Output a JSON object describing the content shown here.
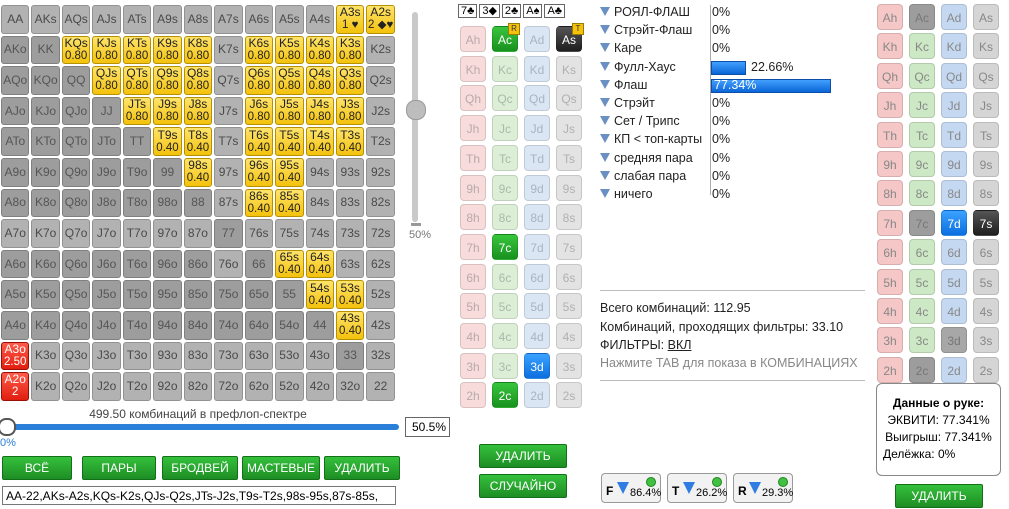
{
  "matrix": {
    "rows": [
      [
        [
          "AA",
          "",
          "g1"
        ],
        [
          "AKs",
          "",
          "g1"
        ],
        [
          "AQs",
          "",
          "g1"
        ],
        [
          "AJs",
          "",
          "g1"
        ],
        [
          "ATs",
          "",
          "g1"
        ],
        [
          "A9s",
          "",
          "g1"
        ],
        [
          "A8s",
          "",
          "g1"
        ],
        [
          "A7s",
          "",
          "g1"
        ],
        [
          "A6s",
          "",
          "g1"
        ],
        [
          "A5s",
          "",
          "g1"
        ],
        [
          "A4s",
          "",
          "g1"
        ],
        [
          "A3s",
          "1 ♥",
          "yel"
        ],
        [
          "A2s",
          "2 ◆♥",
          "yel"
        ]
      ],
      [
        [
          "AKo",
          "",
          "g0"
        ],
        [
          "KK",
          "",
          "g0"
        ],
        [
          "KQs",
          "0.80",
          "yel"
        ],
        [
          "KJs",
          "0.80",
          "yel"
        ],
        [
          "KTs",
          "0.80",
          "yel"
        ],
        [
          "K9s",
          "0.80",
          "yel"
        ],
        [
          "K8s",
          "0.80",
          "yel"
        ],
        [
          "K7s",
          "",
          "g1"
        ],
        [
          "K6s",
          "0.80",
          "yel"
        ],
        [
          "K5s",
          "0.80",
          "yel"
        ],
        [
          "K4s",
          "0.80",
          "yel"
        ],
        [
          "K3s",
          "0.80",
          "yel"
        ],
        [
          "K2s",
          "",
          "g1"
        ]
      ],
      [
        [
          "AQo",
          "",
          "g0"
        ],
        [
          "KQo",
          "",
          "g0"
        ],
        [
          "QQ",
          "",
          "g0"
        ],
        [
          "QJs",
          "0.80",
          "yel"
        ],
        [
          "QTs",
          "0.80",
          "yel"
        ],
        [
          "Q9s",
          "0.80",
          "yel"
        ],
        [
          "Q8s",
          "0.80",
          "yel"
        ],
        [
          "Q7s",
          "",
          "g1"
        ],
        [
          "Q6s",
          "0.80",
          "yel"
        ],
        [
          "Q5s",
          "0.80",
          "yel"
        ],
        [
          "Q4s",
          "0.80",
          "yel"
        ],
        [
          "Q3s",
          "0.80",
          "yel"
        ],
        [
          "Q2s",
          "",
          "g1"
        ]
      ],
      [
        [
          "AJo",
          "",
          "g0"
        ],
        [
          "KJo",
          "",
          "g0"
        ],
        [
          "QJo",
          "",
          "g0"
        ],
        [
          "JJ",
          "",
          "g0"
        ],
        [
          "JTs",
          "0.80",
          "yel"
        ],
        [
          "J9s",
          "0.80",
          "yel"
        ],
        [
          "J8s",
          "0.80",
          "yel"
        ],
        [
          "J7s",
          "",
          "g1"
        ],
        [
          "J6s",
          "0.80",
          "yel"
        ],
        [
          "J5s",
          "0.80",
          "yel"
        ],
        [
          "J4s",
          "0.80",
          "yel"
        ],
        [
          "J3s",
          "0.80",
          "yel"
        ],
        [
          "J2s",
          "",
          "g1"
        ]
      ],
      [
        [
          "ATo",
          "",
          "g0"
        ],
        [
          "KTo",
          "",
          "g0"
        ],
        [
          "QTo",
          "",
          "g0"
        ],
        [
          "JTo",
          "",
          "g0"
        ],
        [
          "TT",
          "",
          "g0"
        ],
        [
          "T9s",
          "0.40",
          "yel"
        ],
        [
          "T8s",
          "0.40",
          "yel"
        ],
        [
          "T7s",
          "",
          "g1"
        ],
        [
          "T6s",
          "0.40",
          "yel"
        ],
        [
          "T5s",
          "0.40",
          "yel"
        ],
        [
          "T4s",
          "0.40",
          "yel"
        ],
        [
          "T3s",
          "0.40",
          "yel"
        ],
        [
          "T2s",
          "",
          "g1"
        ]
      ],
      [
        [
          "A9o",
          "",
          "g0"
        ],
        [
          "K9o",
          "",
          "g0"
        ],
        [
          "Q9o",
          "",
          "g0"
        ],
        [
          "J9o",
          "",
          "g0"
        ],
        [
          "T9o",
          "",
          "g0"
        ],
        [
          "99",
          "",
          "g0"
        ],
        [
          "98s",
          "0.40",
          "yel"
        ],
        [
          "97s",
          "",
          "g1"
        ],
        [
          "96s",
          "0.40",
          "yel"
        ],
        [
          "95s",
          "0.40",
          "yel"
        ],
        [
          "94s",
          "",
          "g1"
        ],
        [
          "93s",
          "",
          "g1"
        ],
        [
          "92s",
          "",
          "g1"
        ]
      ],
      [
        [
          "A8o",
          "",
          "g0"
        ],
        [
          "K8o",
          "",
          "g0"
        ],
        [
          "Q8o",
          "",
          "g0"
        ],
        [
          "J8o",
          "",
          "g0"
        ],
        [
          "T8o",
          "",
          "g0"
        ],
        [
          "98o",
          "",
          "g0"
        ],
        [
          "88",
          "",
          "g0"
        ],
        [
          "87s",
          "",
          "g1"
        ],
        [
          "86s",
          "0.40",
          "yel"
        ],
        [
          "85s",
          "0.40",
          "yel"
        ],
        [
          "84s",
          "",
          "g1"
        ],
        [
          "83s",
          "",
          "g1"
        ],
        [
          "82s",
          "",
          "g1"
        ]
      ],
      [
        [
          "A7o",
          "",
          "g1"
        ],
        [
          "K7o",
          "",
          "g1"
        ],
        [
          "Q7o",
          "",
          "g1"
        ],
        [
          "J7o",
          "",
          "g1"
        ],
        [
          "T7o",
          "",
          "g1"
        ],
        [
          "97o",
          "",
          "g1"
        ],
        [
          "87o",
          "",
          "g1"
        ],
        [
          "77",
          "",
          "g0"
        ],
        [
          "76s",
          "",
          "g1"
        ],
        [
          "75s",
          "",
          "g1"
        ],
        [
          "74s",
          "",
          "g1"
        ],
        [
          "73s",
          "",
          "g1"
        ],
        [
          "72s",
          "",
          "g1"
        ]
      ],
      [
        [
          "A6o",
          "",
          "g0"
        ],
        [
          "K6o",
          "",
          "g0"
        ],
        [
          "Q6o",
          "",
          "g0"
        ],
        [
          "J6o",
          "",
          "g0"
        ],
        [
          "T6o",
          "",
          "g0"
        ],
        [
          "96o",
          "",
          "g0"
        ],
        [
          "86o",
          "",
          "g0"
        ],
        [
          "76o",
          "",
          "g1"
        ],
        [
          "66",
          "",
          "g0"
        ],
        [
          "65s",
          "0.40",
          "yel"
        ],
        [
          "64s",
          "0.40",
          "yel"
        ],
        [
          "63s",
          "",
          "g1"
        ],
        [
          "62s",
          "",
          "g1"
        ]
      ],
      [
        [
          "A5o",
          "",
          "g0"
        ],
        [
          "K5o",
          "",
          "g0"
        ],
        [
          "Q5o",
          "",
          "g0"
        ],
        [
          "J5o",
          "",
          "g0"
        ],
        [
          "T5o",
          "",
          "g0"
        ],
        [
          "95o",
          "",
          "g0"
        ],
        [
          "85o",
          "",
          "g0"
        ],
        [
          "75o",
          "",
          "g0"
        ],
        [
          "65o",
          "",
          "g0"
        ],
        [
          "55",
          "",
          "g0"
        ],
        [
          "54s",
          "0.40",
          "yel"
        ],
        [
          "53s",
          "0.40",
          "yel"
        ],
        [
          "52s",
          "",
          "g1"
        ]
      ],
      [
        [
          "A4o",
          "",
          "g0"
        ],
        [
          "K4o",
          "",
          "g0"
        ],
        [
          "Q4o",
          "",
          "g0"
        ],
        [
          "J4o",
          "",
          "g0"
        ],
        [
          "T4o",
          "",
          "g0"
        ],
        [
          "94o",
          "",
          "g0"
        ],
        [
          "84o",
          "",
          "g0"
        ],
        [
          "74o",
          "",
          "g0"
        ],
        [
          "64o",
          "",
          "g0"
        ],
        [
          "54o",
          "",
          "g0"
        ],
        [
          "44",
          "",
          "g0"
        ],
        [
          "43s",
          "0.40",
          "yel"
        ],
        [
          "42s",
          "",
          "g1"
        ]
      ],
      [
        [
          "A3o",
          "2.50",
          "red"
        ],
        [
          "K3o",
          "",
          "g1"
        ],
        [
          "Q3o",
          "",
          "g1"
        ],
        [
          "J3o",
          "",
          "g1"
        ],
        [
          "T3o",
          "",
          "g1"
        ],
        [
          "93o",
          "",
          "g1"
        ],
        [
          "83o",
          "",
          "g1"
        ],
        [
          "73o",
          "",
          "g1"
        ],
        [
          "63o",
          "",
          "g1"
        ],
        [
          "53o",
          "",
          "g1"
        ],
        [
          "43o",
          "",
          "g1"
        ],
        [
          "33",
          "",
          "g0"
        ],
        [
          "32s",
          "",
          "g1"
        ]
      ],
      [
        [
          "A2o",
          "2",
          "red"
        ],
        [
          "K2o",
          "",
          "g1"
        ],
        [
          "Q2o",
          "",
          "g1"
        ],
        [
          "J2o",
          "",
          "g1"
        ],
        [
          "T2o",
          "",
          "g1"
        ],
        [
          "92o",
          "",
          "g1"
        ],
        [
          "82o",
          "",
          "g1"
        ],
        [
          "72o",
          "",
          "g1"
        ],
        [
          "62o",
          "",
          "g1"
        ],
        [
          "52o",
          "",
          "g1"
        ],
        [
          "42o",
          "",
          "g1"
        ],
        [
          "32o",
          "",
          "g1"
        ],
        [
          "22",
          "",
          "g1"
        ]
      ]
    ]
  },
  "slider": {
    "percent_label": "50%"
  },
  "range": {
    "combos_label": "499.50 комбинаций в префлоп-спектре",
    "percent_value": "50.5%",
    "zero_label": "0%",
    "fill_fraction": 0.505,
    "text": "AA-22,AKs-A2s,KQs-K2s,QJs-Q2s,JTs-J2s,T9s-T2s,98s-95s,87s-85s,"
  },
  "buttons": {
    "all": "ВСЁ",
    "pairs": "ПАРЫ",
    "broadway": "БРОДВЕЙ",
    "suited": "МАСТЕВЫЕ",
    "delete": "УДАЛИТЬ",
    "board_delete": "УДАЛИТЬ",
    "random": "СЛУЧАЙНО",
    "hand_delete": "УДАЛИТЬ"
  },
  "board": [
    "7♣",
    "3◆",
    "2♣",
    "A♠",
    "A♣"
  ],
  "board_cards": {
    "ranks": [
      "A",
      "K",
      "Q",
      "J",
      "T",
      "9",
      "8",
      "7",
      "6",
      "5",
      "4",
      "3",
      "2"
    ],
    "suits": [
      "h",
      "c",
      "d",
      "s"
    ],
    "states": {
      "Ac": "act",
      "As": "act",
      "7c": "act",
      "3d": "act",
      "2c": "act",
      "Ad_dim": "x"
    },
    "tags": {
      "Ac": "R",
      "As": "T"
    }
  },
  "stats": [
    {
      "label": "РОЯЛ-ФЛАШ",
      "value": "0%",
      "fraction": 0
    },
    {
      "label": "Стрэйт-Флаш",
      "value": "0%",
      "fraction": 0
    },
    {
      "label": "Каре",
      "value": "0%",
      "fraction": 0
    },
    {
      "label": "Фулл-Хаус",
      "value": "22.66%",
      "fraction": 0.2266
    },
    {
      "label": "Флаш",
      "value": "77.34%",
      "fraction": 0.7734
    },
    {
      "label": "Стрэйт",
      "value": "0%",
      "fraction": 0
    },
    {
      "label": "Сет / Трипс",
      "value": "0%",
      "fraction": 0
    },
    {
      "label": "КП < топ-карты",
      "value": "0%",
      "fraction": 0
    },
    {
      "label": "средняя пара",
      "value": "0%",
      "fraction": 0
    },
    {
      "label": "слабая пара",
      "value": "0%",
      "fraction": 0
    },
    {
      "label": "ничего",
      "value": "0%",
      "fraction": 0
    }
  ],
  "info": {
    "total": "Всего комбинаций: 112.95",
    "passing": "Комбинаций, проходящих фильтры: 33.10",
    "filters_label": "ФИЛЬТРЫ:",
    "filters_value": "ВКЛ",
    "hint": "Нажмите TAB для показа в КОМБИНАЦИЯХ"
  },
  "filters": [
    {
      "letter": "F",
      "value": "86.4%"
    },
    {
      "letter": "T",
      "value": "26.2%"
    },
    {
      "letter": "R",
      "value": "29.3%"
    }
  ],
  "hand": {
    "title": "Данные о руке:",
    "equity": "ЭКВИТИ: 77.341%",
    "win": "Выигрыш: 77.341%",
    "tie": "Делёжка: 0%"
  },
  "colors": {
    "accent_green": "#1d8d24",
    "accent_blue": "#0d6fe0",
    "highlight_yellow": "#f4c20d"
  }
}
